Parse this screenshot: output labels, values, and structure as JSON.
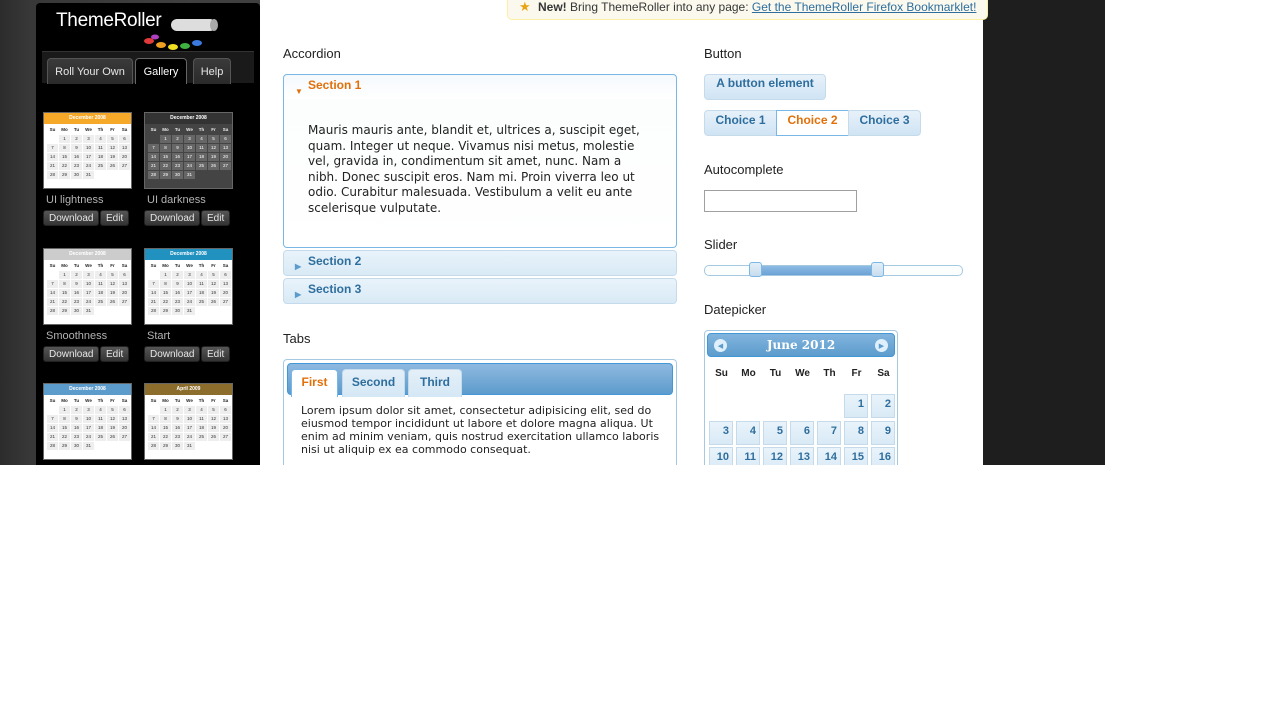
{
  "notice": {
    "new_label": "New!",
    "text": "Bring ThemeRoller into any page:",
    "link": "Get the ThemeRoller Firefox Bookmarklet!"
  },
  "sidebar": {
    "logo": "ThemeRoller",
    "tabs": [
      "Roll Your Own",
      "Gallery",
      "Help"
    ],
    "themes": [
      {
        "name": "UI lightness",
        "header_color": "#f6a828",
        "month": "December 2008"
      },
      {
        "name": "UI darkness",
        "header_color": "#333333",
        "month": "December 2008"
      },
      {
        "name": "Smoothness",
        "header_color": "#cccccc",
        "month": "December 2008"
      },
      {
        "name": "Start",
        "header_color": "#2191c0",
        "month": "December 2008"
      },
      {
        "name": "",
        "header_color": "#5c9ccc",
        "month": "December 2008"
      },
      {
        "name": "",
        "header_color": "#8c6d2c",
        "month": "April 2009"
      }
    ],
    "download_label": "Download",
    "edit_label": "Edit"
  },
  "accordion": {
    "title": "Accordion",
    "sections": [
      "Section 1",
      "Section 2",
      "Section 3"
    ],
    "body": "Mauris mauris ante, blandit et, ultrices a, suscipit eget, quam. Integer ut neque. Vivamus nisi metus, molestie vel, gravida in, condimentum sit amet, nunc. Nam a nibh. Donec suscipit eros. Nam mi. Proin viverra leo ut odio. Curabitur malesuada. Vestibulum a velit eu ante scelerisque vulputate."
  },
  "tabs": {
    "title": "Tabs",
    "items": [
      "First",
      "Second",
      "Third"
    ],
    "content": "Lorem ipsum dolor sit amet, consectetur adipisicing elit, sed do eiusmod tempor incididunt ut labore et dolore magna aliqua. Ut enim ad minim veniam, quis nostrud exercitation ullamco laboris nisi ut aliquip ex ea commodo consequat."
  },
  "button": {
    "title": "Button",
    "single": "A button element",
    "choices": [
      "Choice 1",
      "Choice 2",
      "Choice 3"
    ]
  },
  "autocomplete": {
    "title": "Autocomplete",
    "value": ""
  },
  "slider": {
    "title": "Slider",
    "range_start": 0.2,
    "range_end": 0.67
  },
  "datepicker": {
    "title": "Datepicker",
    "month": "June 2012",
    "days_of_week": [
      "Su",
      "Mo",
      "Tu",
      "We",
      "Th",
      "Fr",
      "Sa"
    ],
    "week1": [
      "1",
      "2"
    ],
    "week2": [
      "3",
      "4",
      "5",
      "6",
      "7",
      "8",
      "9"
    ],
    "week3": [
      "10",
      "11",
      "12",
      "13",
      "14",
      "15",
      "16"
    ]
  },
  "colors": {
    "accent": "#e17009",
    "link": "#2e6e9e",
    "header": "#5c9ccc"
  }
}
